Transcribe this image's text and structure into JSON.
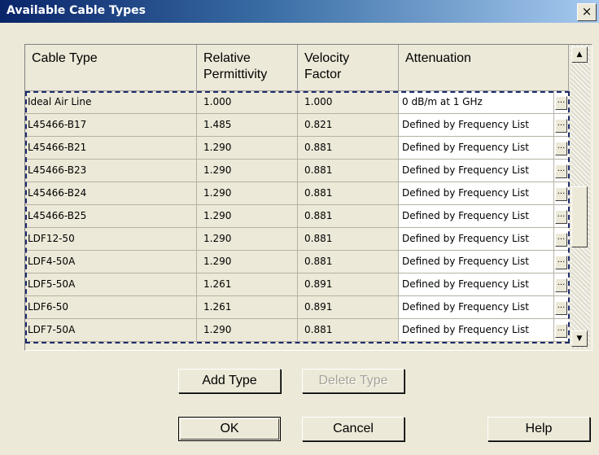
{
  "window": {
    "title": "Available Cable Types",
    "close_label": "×"
  },
  "grid": {
    "columns": [
      {
        "line1": "Cable Type",
        "line2": ""
      },
      {
        "line1": "Relative",
        "line2": "Permittivity"
      },
      {
        "line1": "Velocity",
        "line2": "Factor"
      },
      {
        "line1": "Attenuation",
        "line2": ""
      }
    ],
    "rows": [
      {
        "cable": "Ideal Air Line",
        "permittivity": "1.000",
        "velocity": "1.000",
        "attenuation": "0 dB/m  at 1 GHz"
      },
      {
        "cable": "L45466-B17",
        "permittivity": "1.485",
        "velocity": "0.821",
        "attenuation": "Defined by Frequency List"
      },
      {
        "cable": "L45466-B21",
        "permittivity": "1.290",
        "velocity": "0.881",
        "attenuation": "Defined by Frequency List"
      },
      {
        "cable": "L45466-B23",
        "permittivity": "1.290",
        "velocity": "0.881",
        "attenuation": "Defined by Frequency List"
      },
      {
        "cable": "L45466-B24",
        "permittivity": "1.290",
        "velocity": "0.881",
        "attenuation": "Defined by Frequency List"
      },
      {
        "cable": "L45466-B25",
        "permittivity": "1.290",
        "velocity": "0.881",
        "attenuation": "Defined by Frequency List"
      },
      {
        "cable": "LDF12-50",
        "permittivity": "1.290",
        "velocity": "0.881",
        "attenuation": "Defined by Frequency List"
      },
      {
        "cable": "LDF4-50A",
        "permittivity": "1.290",
        "velocity": "0.881",
        "attenuation": "Defined by Frequency List"
      },
      {
        "cable": "LDF5-50A",
        "permittivity": "1.261",
        "velocity": "0.891",
        "attenuation": "Defined by Frequency List"
      },
      {
        "cable": "LDF6-50",
        "permittivity": "1.261",
        "velocity": "0.891",
        "attenuation": "Defined by Frequency List"
      },
      {
        "cable": "LDF7-50A",
        "permittivity": "1.290",
        "velocity": "0.881",
        "attenuation": "Defined by Frequency List"
      }
    ],
    "ellipsis_label": "...",
    "scroll_position": 0.6
  },
  "buttons": {
    "add_type": "Add Type",
    "delete_type": "Delete Type",
    "ok": "OK",
    "cancel": "Cancel",
    "help": "Help"
  },
  "icons": {
    "scroll_up": "▲",
    "scroll_down": "▼"
  }
}
